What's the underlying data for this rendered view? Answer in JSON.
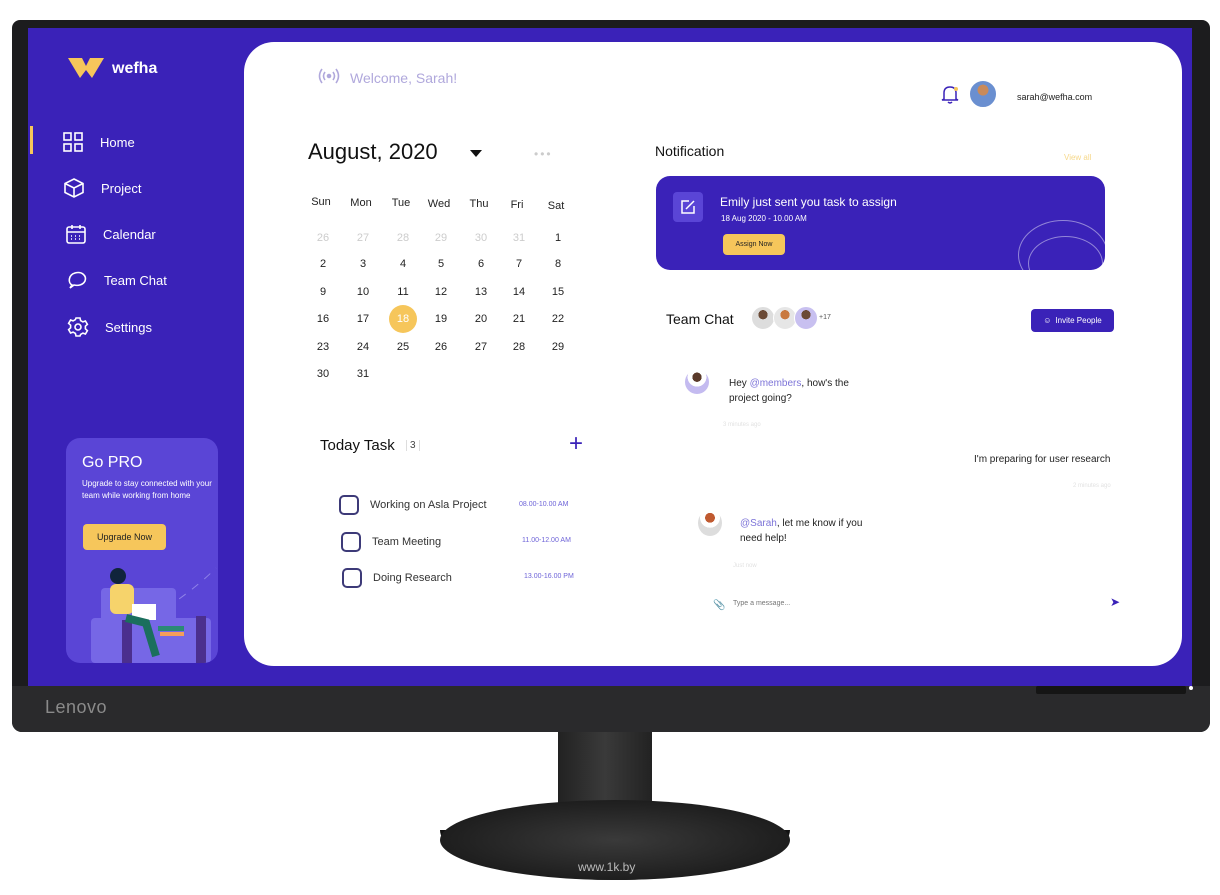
{
  "device": {
    "brand": "Lenovo",
    "watermark": "www.1k.by",
    "watermark_logo": "1K.by"
  },
  "colors": {
    "primary": "#3a22b8",
    "accent": "#f6c65b",
    "card_light": "#5a45d6"
  },
  "sidebar": {
    "logo_text": "wefha",
    "items": [
      {
        "label": "Home",
        "icon": "grid-icon",
        "active": true
      },
      {
        "label": "Project",
        "icon": "cube-icon"
      },
      {
        "label": "Calendar",
        "icon": "calendar-icon"
      },
      {
        "label": "Team Chat",
        "icon": "chat-icon"
      },
      {
        "label": "Settings",
        "icon": "gear-icon"
      }
    ],
    "pro": {
      "title": "Go PRO",
      "text": "Upgrade to stay connected with your team while working from home",
      "button": "Upgrade Now"
    }
  },
  "header": {
    "welcome": "Welcome, Sarah!",
    "email": "sarah@wefha.com"
  },
  "calendar": {
    "month": "August, 2020",
    "weekdays": [
      "Sun",
      "Mon",
      "Tue",
      "Wed",
      "Thu",
      "Fri",
      "Sat"
    ],
    "weeks": [
      [
        "26",
        "27",
        "28",
        "29",
        "30",
        "31",
        "1"
      ],
      [
        "2",
        "3",
        "4",
        "5",
        "6",
        "7",
        "8"
      ],
      [
        "9",
        "10",
        "11",
        "12",
        "13",
        "14",
        "15"
      ],
      [
        "16",
        "17",
        "18",
        "19",
        "20",
        "21",
        "22"
      ],
      [
        "23",
        "24",
        "25",
        "26",
        "27",
        "28",
        "29"
      ],
      [
        "30",
        "31"
      ]
    ],
    "muted_first_row_count": 6,
    "selected": "18"
  },
  "tasks": {
    "title": "Today Task",
    "count": "3",
    "items": [
      {
        "label": "Working on Asla Project",
        "time": "08.00-10.00 AM",
        "done": false
      },
      {
        "label": "Team Meeting",
        "time": "11.00-12.00 AM",
        "done": false
      },
      {
        "label": "Doing Research",
        "time": "13.00-16.00 PM",
        "done": false
      }
    ]
  },
  "notification": {
    "title": "Notification",
    "view_all": "View all",
    "message": "Emily just sent you task to assign",
    "time": "18 Aug 2020 - 10.00 AM",
    "button": "Assign Now"
  },
  "chat": {
    "title": "Team Chat",
    "more_members": "+17",
    "invite": "Invite People",
    "messages": [
      {
        "pre": "Hey ",
        "mention": "@members",
        "post": ", how's the project going?",
        "time": "3 minutes ago"
      },
      {
        "text": "I'm preparing for user research",
        "time": "2 minutes ago"
      },
      {
        "mention": "@Sarah",
        "post": ", let me know if you need help!",
        "time": "Just now"
      }
    ],
    "input_placeholder": "Type a message..."
  }
}
